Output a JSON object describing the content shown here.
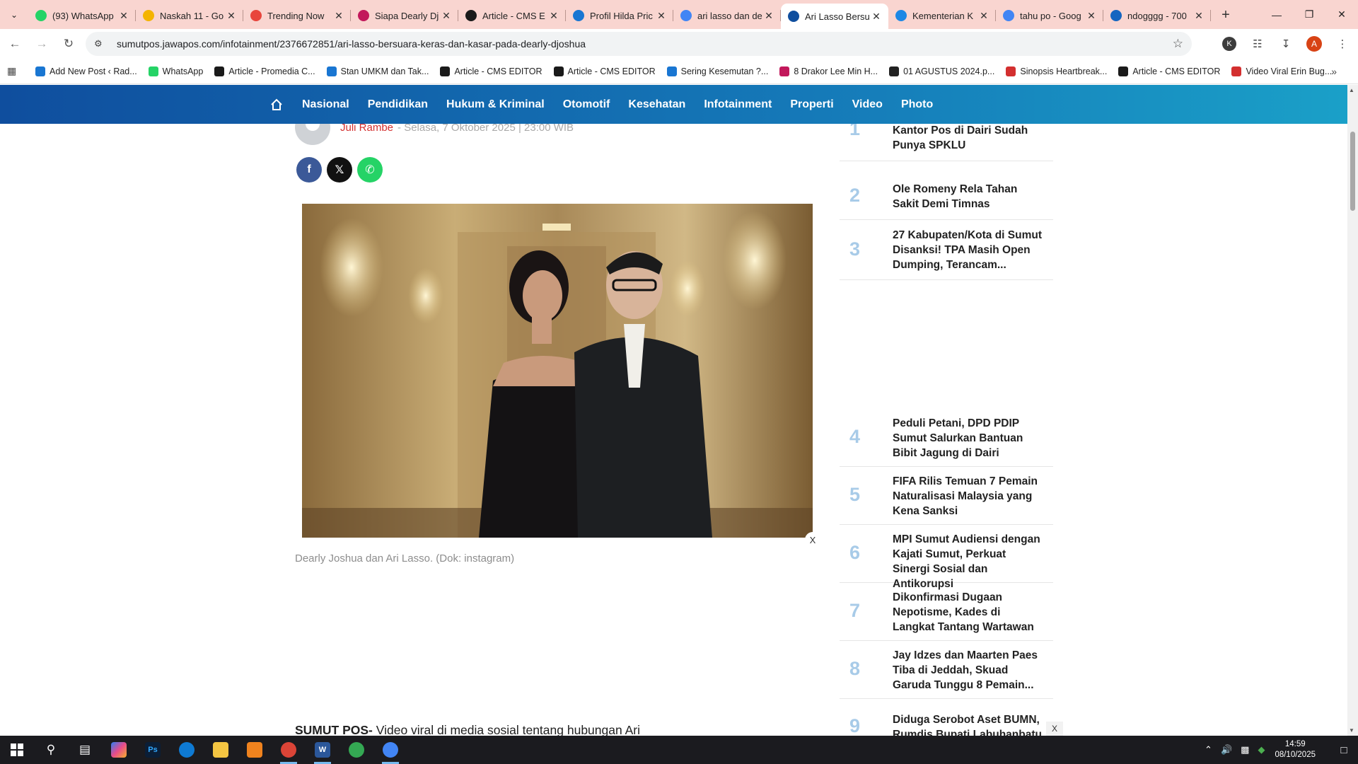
{
  "tabs": [
    {
      "title": "(93) WhatsApp",
      "icon": "whatsapp-icon",
      "color": "#25d366",
      "active": false
    },
    {
      "title": "Naskah 11 - Go",
      "icon": "google-drive-icon",
      "color": "#f4b400",
      "active": false
    },
    {
      "title": "Trending Now",
      "icon": "trending-icon",
      "color": "#e8453c",
      "active": false
    },
    {
      "title": "Siapa Dearly Dj",
      "icon": "s-logo-icon",
      "color": "#c2185b",
      "active": false
    },
    {
      "title": "Article - CMS E",
      "icon": "jp-logo-icon",
      "color": "#1a1a1a",
      "active": false
    },
    {
      "title": "Profil Hilda Pric",
      "icon": "bookmark-blue-icon",
      "color": "#1976d2",
      "active": false
    },
    {
      "title": "ari lasso dan de",
      "icon": "google-icon",
      "color": "#4285f4",
      "active": false
    },
    {
      "title": "Ari Lasso Bersu",
      "icon": "jawapos-icon",
      "color": "#0f4e9e",
      "active": true
    },
    {
      "title": "Kementerian K",
      "icon": "ministry-icon",
      "color": "#1e88e5",
      "active": false
    },
    {
      "title": "tahu po - Goog",
      "icon": "google-icon",
      "color": "#4285f4",
      "active": false
    },
    {
      "title": "ndogggg - 700",
      "icon": "globe-icon",
      "color": "#1565c0",
      "active": false
    }
  ],
  "address": {
    "url": "sumutpos.jawapos.com/infotainment/2376672851/ari-lasso-bersuara-keras-dan-kasar-pada-dearly-djoshua",
    "profile_letter_k": "K",
    "profile_letter_a": "A"
  },
  "bookmarks": [
    {
      "label": "Add New Post ‹ Rad...",
      "color": "#1976d2"
    },
    {
      "label": "WhatsApp",
      "color": "#25d366"
    },
    {
      "label": "Article - Promedia C...",
      "color": "#1a1a1a"
    },
    {
      "label": "Stan UMKM dan Tak...",
      "color": "#1976d2"
    },
    {
      "label": "Article - CMS EDITOR",
      "color": "#1a1a1a"
    },
    {
      "label": "Article - CMS EDITOR",
      "color": "#1a1a1a"
    },
    {
      "label": "Sering Kesemutan ?...",
      "color": "#1976d2"
    },
    {
      "label": "8 Drakor Lee Min H...",
      "color": "#c2185b"
    },
    {
      "label": "01 AGUSTUS 2024.p...",
      "color": "#222222"
    },
    {
      "label": "Sinopsis Heartbreak...",
      "color": "#d32f2f"
    },
    {
      "label": "Article - CMS EDITOR",
      "color": "#1a1a1a"
    },
    {
      "label": "Video Viral Erin Bug...",
      "color": "#d32f2f"
    }
  ],
  "sitenav": [
    "Nasional",
    "Pendidikan",
    "Hukum & Kriminal",
    "Otomotif",
    "Kesehatan",
    "Infotainment",
    "Properti",
    "Video",
    "Photo"
  ],
  "article": {
    "author": "Juli Rambe",
    "date": "- Selasa, 7 Oktober 2025 | 23:00 WIB",
    "caption": "Dearly Joshua dan Ari Lasso. (Dok: instagram)",
    "lead_bold": "SUMUT POS-",
    "lead_text": " Video viral di media sosial tentang hubungan Ari",
    "close_label": "X"
  },
  "sidebar": [
    {
      "num": "1",
      "title": "Tanpa Sorotan Publik, Tiga Kantor Pos di Dairi Sudah Punya SPKLU"
    },
    {
      "num": "2",
      "title": "Ole Romeny Rela Tahan Sakit Demi Timnas"
    },
    {
      "num": "3",
      "title": "27 Kabupaten/Kota di Sumut Disanksi! TPA Masih Open Dumping, Terancam..."
    },
    {
      "num": "4",
      "title": "Peduli Petani, DPD PDIP Sumut Salurkan Bantuan Bibit Jagung di Dairi"
    },
    {
      "num": "5",
      "title": "FIFA Rilis Temuan 7 Pemain Naturalisasi Malaysia yang Kena Sanksi"
    },
    {
      "num": "6",
      "title": "MPI Sumut Audiensi dengan Kajati Sumut, Perkuat Sinergi Sosial dan Antikorupsi"
    },
    {
      "num": "7",
      "title": "Dikonfirmasi Dugaan Nepotisme, Kades di Langkat Tantang Wartawan"
    },
    {
      "num": "8",
      "title": "Jay Idzes dan Maarten Paes Tiba di Jeddah, Skuad Garuda Tunggu 8 Pemain..."
    },
    {
      "num": "9",
      "title": "Diduga Serobot Aset BUMN, Rumdis Bupati Labuhanbatu"
    }
  ],
  "sidebar_close": "X",
  "taskbar": {
    "time": "14:59",
    "date": "08/10/2025"
  }
}
